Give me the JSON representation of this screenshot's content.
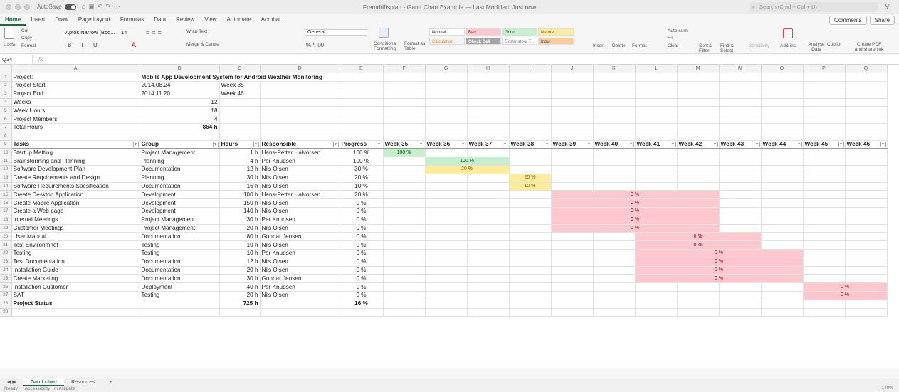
{
  "window": {
    "autosave_label": "AutoSave",
    "title": "Fremdriftsplan - Gantt Chart Example — Last Modified: Just now",
    "search_placeholder": "Search (Cmd + Ctrl + U)"
  },
  "ribbon_tabs": [
    "Home",
    "Insert",
    "Draw",
    "Page Layout",
    "Formulas",
    "Data",
    "Review",
    "View",
    "Automate",
    "Acrobat"
  ],
  "ribbon_right": {
    "comments": "Comments",
    "share": "Share"
  },
  "ribbon": {
    "paste": "Paste",
    "cut": "Cut",
    "copy": "Copy",
    "format": "Format",
    "font": "Aptos Narrow (Bod...",
    "font_size": "14",
    "wrap_text": "Wrap Text",
    "merge": "Merge & Centre",
    "number_format": "General",
    "conditional": "Conditional Formatting",
    "format_table": "Format as Table",
    "styles": {
      "normal": "Normal",
      "bad": "Bad",
      "good": "Good",
      "neutral": "Neutral",
      "calculation": "Calculation",
      "check_cell": "Check Cell",
      "explanatory": "Explanatory T...",
      "input": "Input"
    },
    "insert": "Insert",
    "delete": "Delete",
    "format_cells": "Format",
    "autosum": "Auto-sum",
    "fill": "Fill",
    "clear": "Clear",
    "sort_filter": "Sort & Filter",
    "find_select": "Find & Select",
    "sensitivity": "Sensitivity",
    "addins": "Add-ins",
    "analyse": "Analyse Data",
    "copilot": "Copilot",
    "create_pdf": "Create PDF and share link"
  },
  "formula_bar": {
    "cell": "Q34",
    "fx": "fx"
  },
  "columns": [
    "A",
    "B",
    "C",
    "D",
    "E",
    "F",
    "G",
    "H",
    "I",
    "J",
    "K",
    "L",
    "M",
    "N",
    "O",
    "P",
    "Q"
  ],
  "info": {
    "project_label": "Project:",
    "project_value": "Mobile App Development System for Android Weather Monitoring",
    "start_label": "Project Start:",
    "start_value": "2014.08.24",
    "start_week": "Week 35",
    "end_label": "Project End:",
    "end_value": "2014.11.20",
    "end_week": "Week 46",
    "weeks_label": "Weeks",
    "weeks_value": "12",
    "week_hours_label": "Week Hours",
    "week_hours_value": "18",
    "members_label": "Project Members",
    "members_value": "4",
    "total_label": "Total Hours",
    "total_value": "864 h"
  },
  "table_headers": [
    "Tasks",
    "Group",
    "Hours",
    "Responsible",
    "Progress",
    "Week 35",
    "Week 36",
    "Week 37",
    "Week 38",
    "Week 39",
    "Week 40",
    "Week 41",
    "Week 42",
    "Week 43",
    "Week 44",
    "Week 45",
    "Week 46"
  ],
  "tasks": [
    {
      "task": "Startup Metting",
      "group": "Project Management",
      "hours": "1 h",
      "resp": "Hans-Petter Halvorsen",
      "progress": "100 %",
      "bar": {
        "start": 0,
        "span": 1,
        "color": "green",
        "label": "100 %"
      }
    },
    {
      "task": "Brainstorming and Planning",
      "group": "Planning",
      "hours": "4 h",
      "resp": "Per Knudsen",
      "progress": "100 %",
      "bar": {
        "start": 1,
        "span": 2,
        "color": "green",
        "label": "100 %"
      }
    },
    {
      "task": "Software Development Plan",
      "group": "Documentation",
      "hours": "12 h",
      "resp": "Nils Olsen",
      "progress": "30 %",
      "bar": {
        "start": 1,
        "span": 2,
        "color": "yellow",
        "label": "20 %"
      }
    },
    {
      "task": "Create Requirements and Design",
      "group": "Planning",
      "hours": "30 h",
      "resp": "Nils Olsen",
      "progress": "20 %",
      "bar": {
        "start": 3,
        "span": 1,
        "color": "yellow",
        "label": "20 %"
      }
    },
    {
      "task": "Software Requirements Spesification",
      "group": "Documentation",
      "hours": "16 h",
      "resp": "Nils Olsen",
      "progress": "10 %",
      "bar": {
        "start": 3,
        "span": 1,
        "color": "yellow",
        "label": "10 %"
      }
    },
    {
      "task": "Create Desktop Application",
      "group": "Development",
      "hours": "100 h",
      "resp": "Hans-Petter Halvorsen",
      "progress": "20 %",
      "bar": {
        "start": 4,
        "span": 4,
        "color": "red",
        "label": "0 %"
      }
    },
    {
      "task": "Create Mobile Application",
      "group": "Development",
      "hours": "150 h",
      "resp": "Nils Olsen",
      "progress": "0 %",
      "bar": {
        "start": 4,
        "span": 4,
        "color": "red",
        "label": "0 %"
      }
    },
    {
      "task": "Create a Web page",
      "group": "Development",
      "hours": "140 h",
      "resp": "Nils Olsen",
      "progress": "0 %",
      "bar": {
        "start": 4,
        "span": 4,
        "color": "red",
        "label": "0 %"
      }
    },
    {
      "task": "Internal Meetings",
      "group": "Project Management",
      "hours": "30 h",
      "resp": "Per Knudsen",
      "progress": "0 %",
      "bar": {
        "start": 4,
        "span": 4,
        "color": "red",
        "label": "0 %"
      }
    },
    {
      "task": "Customer Meetings",
      "group": "Project Management",
      "hours": "20 h",
      "resp": "Nils Olsen",
      "progress": "0 %",
      "bar": {
        "start": 4,
        "span": 4,
        "color": "red",
        "label": "0 %"
      }
    },
    {
      "task": "User Manual",
      "group": "Documentation",
      "hours": "80 h",
      "resp": "Gunnar Jensen",
      "progress": "0 %",
      "bar": {
        "start": 6,
        "span": 3,
        "color": "red",
        "label": "0 %"
      }
    },
    {
      "task": "Test Environmnet",
      "group": "Testing",
      "hours": "10 h",
      "resp": "Nils Olsen",
      "progress": "0 %",
      "bar": {
        "start": 6,
        "span": 3,
        "color": "red",
        "label": "0 %"
      }
    },
    {
      "task": "Testing",
      "group": "Testing",
      "hours": "10 h",
      "resp": "Per Knudsen",
      "progress": "0 %",
      "bar": {
        "start": 6,
        "span": 4,
        "color": "red",
        "label": "0 %"
      }
    },
    {
      "task": "Test Documentation",
      "group": "Documentation",
      "hours": "12 h",
      "resp": "Nils Olsen",
      "progress": "0 %",
      "bar": {
        "start": 6,
        "span": 4,
        "color": "red",
        "label": "0 %"
      }
    },
    {
      "task": "Installation Guide",
      "group": "Documentation",
      "hours": "20 h",
      "resp": "Nils Olsen",
      "progress": "0 %",
      "bar": {
        "start": 6,
        "span": 4,
        "color": "red",
        "label": "0 %"
      }
    },
    {
      "task": "Create Marketing",
      "group": "Documentation",
      "hours": "30 h",
      "resp": "Gunnar Jensen",
      "progress": "0 %",
      "bar": {
        "start": 6,
        "span": 4,
        "color": "red",
        "label": "0 %"
      }
    },
    {
      "task": "Installation Customer",
      "group": "Deployment",
      "hours": "40 h",
      "resp": "Per Knudsen",
      "progress": "0 %",
      "bar": {
        "start": 10,
        "span": 2,
        "color": "red",
        "label": "0 %"
      }
    },
    {
      "task": "SAT",
      "group": "Testing",
      "hours": "20 h",
      "resp": "Nils Olsen",
      "progress": "0 %",
      "bar": {
        "start": 10,
        "span": 2,
        "color": "red",
        "label": "0 %"
      }
    }
  ],
  "status_row": {
    "label": "Project Status",
    "hours": "725 h",
    "progress": "16 %"
  },
  "sheet_tabs": [
    "Gantt chart",
    "Resources"
  ],
  "statusbar": {
    "ready": "Ready",
    "accessibility": "Accessibility: Investigate",
    "zoom": "140%"
  }
}
